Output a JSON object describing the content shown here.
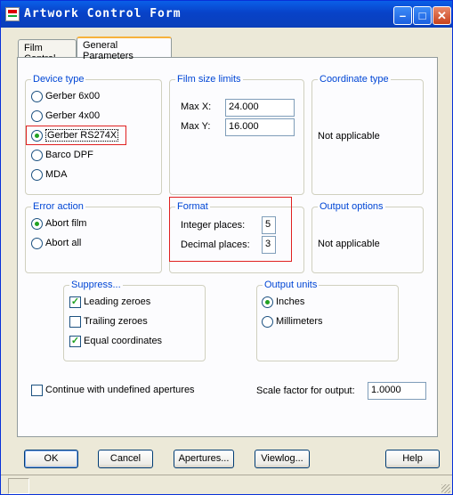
{
  "window": {
    "title": "Artwork Control Form",
    "buttons": {
      "minimize": "–",
      "maximize": "□",
      "close": "✕"
    }
  },
  "tabs": [
    {
      "label": "Film Control",
      "active": false
    },
    {
      "label": "General Parameters",
      "active": true
    }
  ],
  "device_type": {
    "legend": "Device type",
    "options": [
      "Gerber 6x00",
      "Gerber 4x00",
      "Gerber RS274X",
      "Barco DPF",
      "MDA"
    ],
    "selected": "Gerber RS274X"
  },
  "film_size": {
    "legend": "Film size limits",
    "max_x_label": "Max X:",
    "max_x_value": "24.000",
    "max_y_label": "Max Y:",
    "max_y_value": "16.000"
  },
  "coordinate_type": {
    "legend": "Coordinate type",
    "text": "Not applicable"
  },
  "error_action": {
    "legend": "Error action",
    "options": [
      "Abort film",
      "Abort all"
    ],
    "selected": "Abort film"
  },
  "format": {
    "legend": "Format",
    "integer_label": "Integer places:",
    "integer_value": "5",
    "decimal_label": "Decimal places:",
    "decimal_value": "3"
  },
  "output_options": {
    "legend": "Output options",
    "text": "Not applicable"
  },
  "suppress": {
    "legend": "Suppress...",
    "items": [
      {
        "label": "Leading zeroes",
        "checked": true
      },
      {
        "label": "Trailing zeroes",
        "checked": false
      },
      {
        "label": "Equal coordinates",
        "checked": true
      }
    ]
  },
  "output_units": {
    "legend": "Output units",
    "options": [
      "Inches",
      "Millimeters"
    ],
    "selected": "Inches"
  },
  "continue_undefined": {
    "label": "Continue with undefined apertures",
    "checked": false
  },
  "scale_factor": {
    "label": "Scale factor for output:",
    "value": "1.0000"
  },
  "buttons": {
    "ok": "OK",
    "cancel": "Cancel",
    "apertures": "Apertures...",
    "viewlog": "Viewlog...",
    "help": "Help"
  },
  "colors": {
    "title_bar": "#0842c8",
    "group_legend": "#0046d5",
    "highlight_box": "#e02020",
    "radio_dot": "#21a121"
  }
}
